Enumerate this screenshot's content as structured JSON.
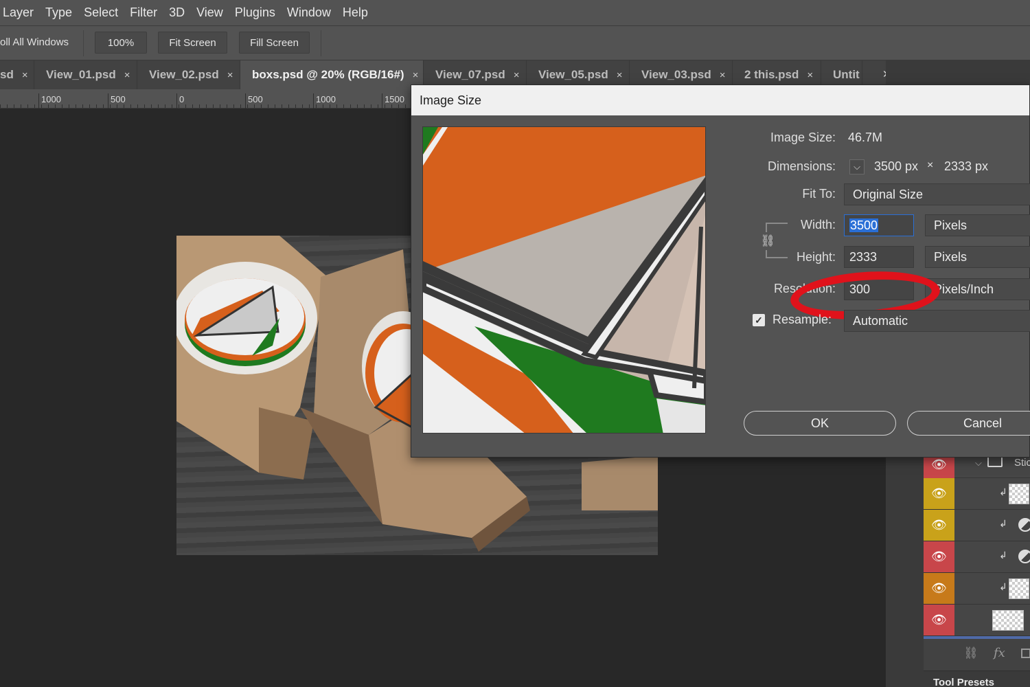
{
  "menu": [
    "Layer",
    "Type",
    "Select",
    "Filter",
    "3D",
    "View",
    "Plugins",
    "Window",
    "Help"
  ],
  "options": {
    "scroll_all": "oll All Windows",
    "zoom_100": "100%",
    "fit_screen": "Fit Screen",
    "fill_screen": "Fill Screen"
  },
  "tabs": [
    {
      "label": "sd",
      "close": "×"
    },
    {
      "label": "View_01.psd",
      "close": "×"
    },
    {
      "label": "View_02.psd",
      "close": "×"
    },
    {
      "label": "boxs.psd @ 20% (RGB/16#)",
      "close": "×"
    },
    {
      "label": "View_07.psd",
      "close": "×"
    },
    {
      "label": "View_05.psd",
      "close": "×"
    },
    {
      "label": "View_03.psd",
      "close": "×"
    },
    {
      "label": "2 this.psd",
      "close": "×"
    },
    {
      "label": "Untit"
    }
  ],
  "tab_overflow": "»",
  "ruler": [
    "1000",
    "500",
    "0",
    "500",
    "1000",
    "1500"
  ],
  "dialog": {
    "title": "Image Size",
    "image_size_label": "Image Size:",
    "image_size_value": "46.7M",
    "dimensions_label": "Dimensions:",
    "dim_width": "3500 px",
    "dim_x": "×",
    "dim_height": "2333 px",
    "fit_to_label": "Fit To:",
    "fit_to_value": "Original Size",
    "width_label": "Width:",
    "width_value": "3500",
    "width_unit": "Pixels",
    "height_label": "Height:",
    "height_value": "2333",
    "height_unit": "Pixels",
    "resolution_label": "Resolution:",
    "resolution_value": "300",
    "resolution_unit": "Pixels/Inch",
    "resample_label": "Resample:",
    "resample_value": "Automatic",
    "resample_checked": true,
    "ok": "OK",
    "cancel": "Cancel"
  },
  "layers": {
    "group_label": "Stic",
    "eye_colors": [
      "#c8464a",
      "#c9a21a",
      "#c9a21a",
      "#c8464a",
      "#c77a1a",
      "#c8464a"
    ]
  },
  "bottom_panel": {
    "tool_presets": "Tool Presets",
    "fx": "fx"
  },
  "colors": {
    "accent_red": "#e0121b",
    "selection_blue": "#2a6fd6",
    "orange": "#d6601c",
    "green": "#1f7a1f"
  }
}
